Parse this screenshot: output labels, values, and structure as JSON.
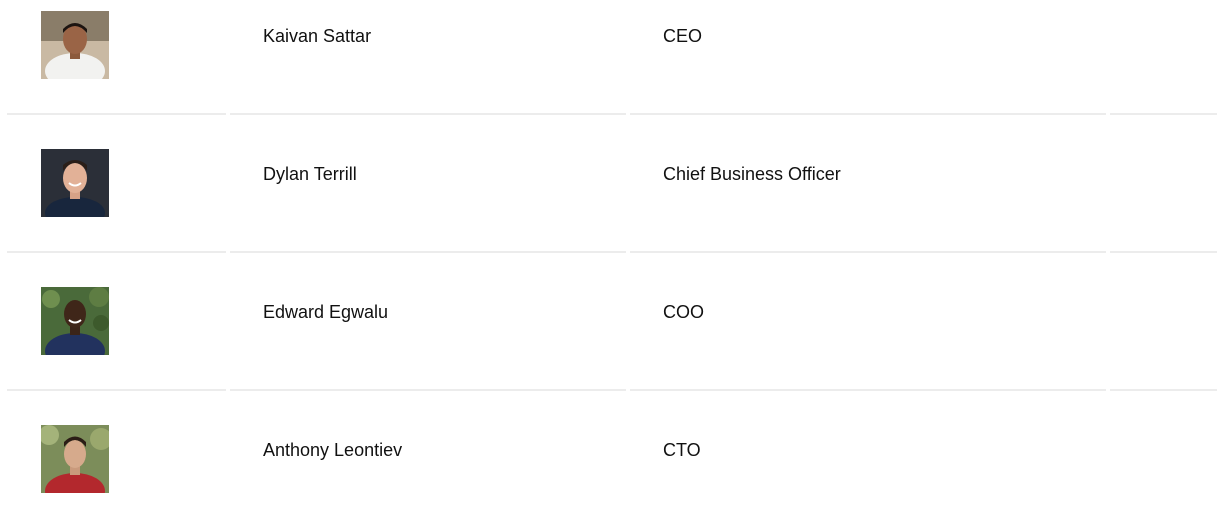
{
  "team": [
    {
      "name": "Kaivan Sattar",
      "role": "CEO"
    },
    {
      "name": "Dylan Terrill",
      "role": "Chief Business Officer"
    },
    {
      "name": "Edward Egwalu",
      "role": "COO"
    },
    {
      "name": "Anthony Leontiev",
      "role": "CTO"
    }
  ],
  "colors": {
    "text": "#111111",
    "divider": "#ececec",
    "background": "#ffffff"
  }
}
